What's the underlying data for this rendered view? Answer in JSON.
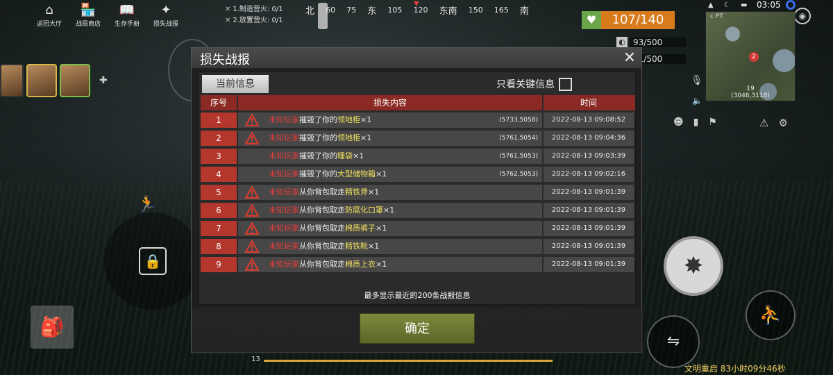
{
  "top_menu": [
    {
      "label": "返回大厅",
      "icon": "home-icon",
      "glyph": "⌂"
    },
    {
      "label": "战局商店",
      "icon": "shop-icon",
      "glyph": "🏪"
    },
    {
      "label": "生存手册",
      "icon": "book-icon",
      "glyph": "📖"
    },
    {
      "label": "损失战报",
      "icon": "damage-report-icon",
      "glyph": "✦"
    }
  ],
  "quests": [
    {
      "mark": "✕",
      "text": "1.制造营火: 0/1"
    },
    {
      "mark": "✕",
      "text": "2.放置营火: 0/1"
    }
  ],
  "compass": {
    "ticks": [
      "北",
      "60",
      "75",
      "东",
      "105",
      "120",
      "东南",
      "150",
      "165",
      "南"
    ],
    "marker": "▼"
  },
  "status": {
    "health": "107/140",
    "food": "93/500",
    "water": "91/500",
    "food_icon": "food-icon",
    "water_icon": "water-icon",
    "heart_glyph": "♥"
  },
  "system": {
    "clock": "03:05",
    "icons": "▲ ☾ ▬"
  },
  "minimap": {
    "label": "c PT",
    "zone": "19",
    "coord": "(3046,3118)",
    "badge": "2"
  },
  "restart_text": "文明重启 83小时09分46秒",
  "hotbar": {
    "number": "13",
    "progress": 1.0
  },
  "dialog": {
    "title": "损失战报",
    "close_glyph": "✕",
    "tab_current": "当前信息",
    "filter_label": "只看关键信息",
    "columns": [
      "序号",
      "损失内容",
      "时间"
    ],
    "attacker": "未知玩家",
    "rows": [
      {
        "idx": "1",
        "warn": true,
        "verb": "摧毁了你的",
        "item": "领地柜",
        "qty": "×1",
        "coord": "(5733,5058)",
        "time": "2022-08-13 09:08:52"
      },
      {
        "idx": "2",
        "warn": true,
        "verb": "摧毁了你的",
        "item": "领地柜",
        "qty": "×1",
        "coord": "(5761,5054)",
        "time": "2022-08-13 09:04:36"
      },
      {
        "idx": "3",
        "warn": false,
        "verb": "摧毁了你的",
        "item": "睡袋",
        "qty": "×1",
        "coord": "(5761,5053)",
        "time": "2022-08-13 09:03:39"
      },
      {
        "idx": "4",
        "warn": false,
        "verb": "摧毁了你的",
        "item": "大型储物箱",
        "qty": "×1",
        "coord": "(5762,5053)",
        "time": "2022-08-13 09:02:16"
      },
      {
        "idx": "5",
        "warn": true,
        "verb": "从你背包取走",
        "item": "精铁斧",
        "qty": "×1",
        "coord": "",
        "time": "2022-08-13 09:01:39"
      },
      {
        "idx": "6",
        "warn": true,
        "verb": "从你背包取走",
        "item": "防腐化口罩",
        "qty": "×1",
        "coord": "",
        "time": "2022-08-13 09:01:39"
      },
      {
        "idx": "7",
        "warn": true,
        "verb": "从你背包取走",
        "item": "棉质裤子",
        "qty": "×1",
        "coord": "",
        "time": "2022-08-13 09:01:39"
      },
      {
        "idx": "8",
        "warn": true,
        "verb": "从你背包取走",
        "item": "精铁靴",
        "qty": "×1",
        "coord": "",
        "time": "2022-08-13 09:01:39"
      },
      {
        "idx": "9",
        "warn": true,
        "verb": "从你背包取走",
        "item": "棉质上衣",
        "qty": "×1",
        "coord": "",
        "time": "2022-08-13 09:01:39"
      }
    ],
    "limit_note": "最多显示最近的200条战报信息",
    "confirm_label": "确定"
  },
  "colors": {
    "header_red": "#8b2a24",
    "index_red": "#b3372c",
    "attacker_red": "#e23d3d",
    "item_yellow": "#f0e060",
    "health_orange": "#d77b1c",
    "confirm_green": "#6f7a33"
  }
}
